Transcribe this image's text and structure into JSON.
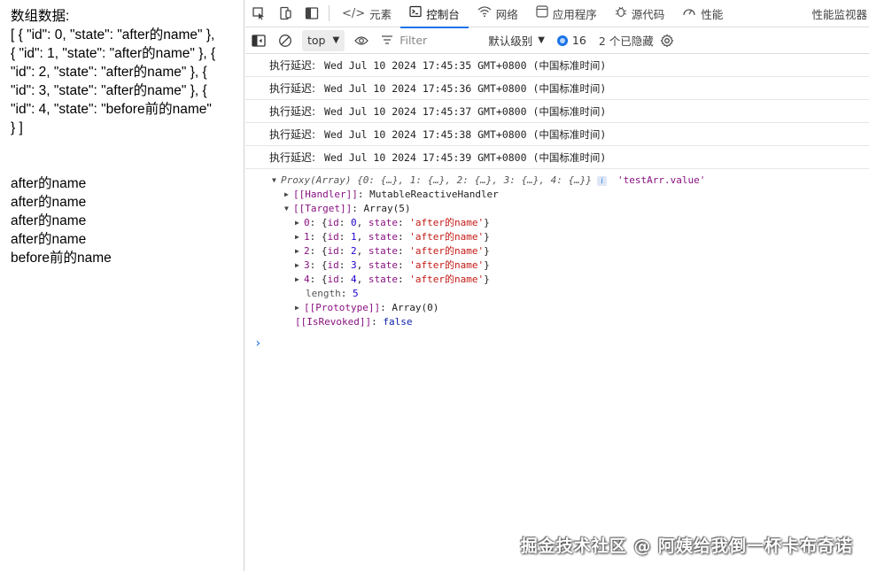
{
  "page": {
    "label": "数组数据:",
    "json_lines": [
      "[ { \"id\": 0, \"state\": \"after的name\" },",
      "{ \"id\": 1, \"state\": \"after的name\" }, {",
      "\"id\": 2, \"state\": \"after的name\" }, {",
      "\"id\": 3, \"state\": \"after的name\" }, {",
      "\"id\": 4, \"state\": \"before前的name\"",
      "} ]"
    ],
    "items": [
      "after的name",
      "after的name",
      "after的name",
      "after的name",
      "before前的name"
    ]
  },
  "devtools": {
    "tabs": [
      {
        "label": "元素",
        "icon": "code-icon"
      },
      {
        "label": "控制台",
        "icon": "console-icon",
        "active": true
      },
      {
        "label": "网络",
        "icon": "wifi-icon"
      },
      {
        "label": "应用程序",
        "icon": "application-icon"
      },
      {
        "label": "源代码",
        "icon": "bug-icon"
      },
      {
        "label": "性能",
        "icon": "gauge-icon"
      }
    ],
    "right_tab": "性能监视器",
    "toolbar": {
      "context": "top",
      "filter_placeholder": "Filter",
      "levels": "默认级别",
      "issues_count": "16",
      "hidden": "2 个已隐藏"
    }
  },
  "console": {
    "logs": [
      {
        "prefix": "执行延迟:",
        "text": "Wed Jul 10 2024 17:45:35 GMT+0800 (中国标准时间)"
      },
      {
        "prefix": "执行延迟:",
        "text": "Wed Jul 10 2024 17:45:36 GMT+0800 (中国标准时间)"
      },
      {
        "prefix": "执行延迟:",
        "text": "Wed Jul 10 2024 17:45:37 GMT+0800 (中国标准时间)"
      },
      {
        "prefix": "执行延迟:",
        "text": "Wed Jul 10 2024 17:45:38 GMT+0800 (中国标准时间)"
      },
      {
        "prefix": "执行延迟:",
        "text": "Wed Jul 10 2024 17:45:39 GMT+0800 (中国标准时间)"
      }
    ],
    "object": {
      "summary": "Proxy(Array) {0: {…}, 1: {…}, 2: {…}, 3: {…}, 4: {…}}",
      "ref": "'testArr.value'",
      "handler_key": "[[Handler]]",
      "handler_val": "MutableReactiveHandler",
      "target_key": "[[Target]]",
      "target_val": "Array(5)",
      "entries": [
        {
          "idx": "0",
          "id": "0",
          "state": "'after的name'"
        },
        {
          "idx": "1",
          "id": "1",
          "state": "'after的name'"
        },
        {
          "idx": "2",
          "id": "2",
          "state": "'after的name'"
        },
        {
          "idx": "3",
          "id": "3",
          "state": "'after的name'"
        },
        {
          "idx": "4",
          "id": "4",
          "state": "'after的name'"
        }
      ],
      "length_key": "length",
      "length_val": "5",
      "proto_key": "[[Prototype]]",
      "proto_val": "Array(0)",
      "revoked_key": "[[IsRevoked]]",
      "revoked_val": "false"
    },
    "prompt": "›"
  },
  "watermark": "掘金技术社区 @ 阿姨给我倒一杯卡布奇诺"
}
